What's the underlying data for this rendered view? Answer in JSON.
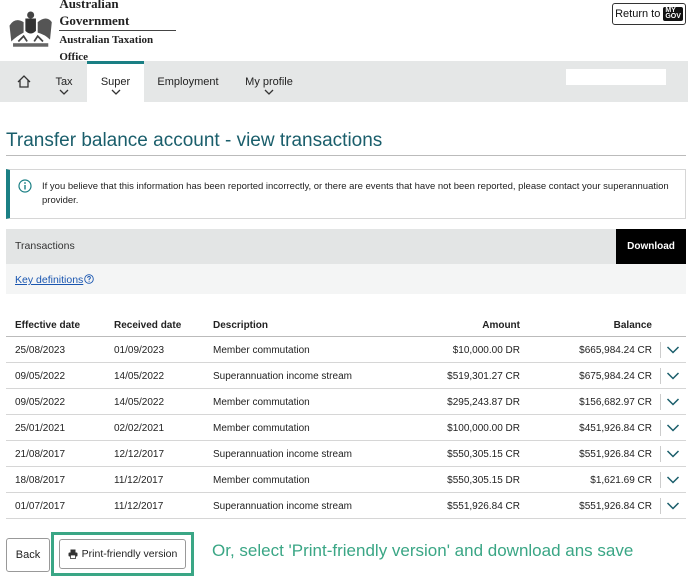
{
  "header": {
    "gov_line": "Australian Government",
    "dept_line": "Australian Taxation Office",
    "return_label": "Return to",
    "mygov_top": "MY",
    "mygov_bottom": "GOV"
  },
  "nav": {
    "items": [
      {
        "label": "Tax"
      },
      {
        "label": "Super"
      },
      {
        "label": "Employment"
      },
      {
        "label": "My profile"
      }
    ],
    "active": "Super",
    "search_placeholder": ""
  },
  "page": {
    "title": "Transfer balance account - view transactions",
    "info": "If you believe that this information has been reported incorrectly, or there are events that have not been reported, please contact your superannuation provider."
  },
  "transactions": {
    "label": "Transactions",
    "download_label": "Download",
    "key_definitions": "Key definitions",
    "columns": [
      "Effective date",
      "Received date",
      "Description",
      "Amount",
      "Balance"
    ],
    "rows": [
      {
        "effective": "25/08/2023",
        "received": "01/09/2023",
        "description": "Member commutation",
        "amount": "$10,000.00 DR",
        "balance": "$665,984.24 CR"
      },
      {
        "effective": "09/05/2022",
        "received": "14/05/2022",
        "description": "Superannuation income stream",
        "amount": "$519,301.27 CR",
        "balance": "$675,984.24 CR"
      },
      {
        "effective": "09/05/2022",
        "received": "14/05/2022",
        "description": "Member commutation",
        "amount": "$295,243.87 DR",
        "balance": "$156,682.97 CR"
      },
      {
        "effective": "25/01/2021",
        "received": "02/02/2021",
        "description": "Member commutation",
        "amount": "$100,000.00 DR",
        "balance": "$451,926.84 CR"
      },
      {
        "effective": "21/08/2017",
        "received": "12/12/2017",
        "description": "Superannuation income stream",
        "amount": "$550,305.15 CR",
        "balance": "$551,926.84 CR"
      },
      {
        "effective": "18/08/2017",
        "received": "11/12/2017",
        "description": "Member commutation",
        "amount": "$550,305.15 DR",
        "balance": "$1,621.69 CR"
      },
      {
        "effective": "01/07/2017",
        "received": "11/12/2017",
        "description": "Superannuation income stream",
        "amount": "$551,926.84 CR",
        "balance": "$551,926.84 CR"
      }
    ]
  },
  "footer": {
    "back_label": "Back",
    "print_label": "Print-friendly version",
    "annotation": "Or, select 'Print-friendly version' and download ans save"
  },
  "colors": {
    "accent": "#1a7f84",
    "title": "#1a5e6b",
    "highlight": "#3aa685",
    "link": "#1a56b0"
  }
}
